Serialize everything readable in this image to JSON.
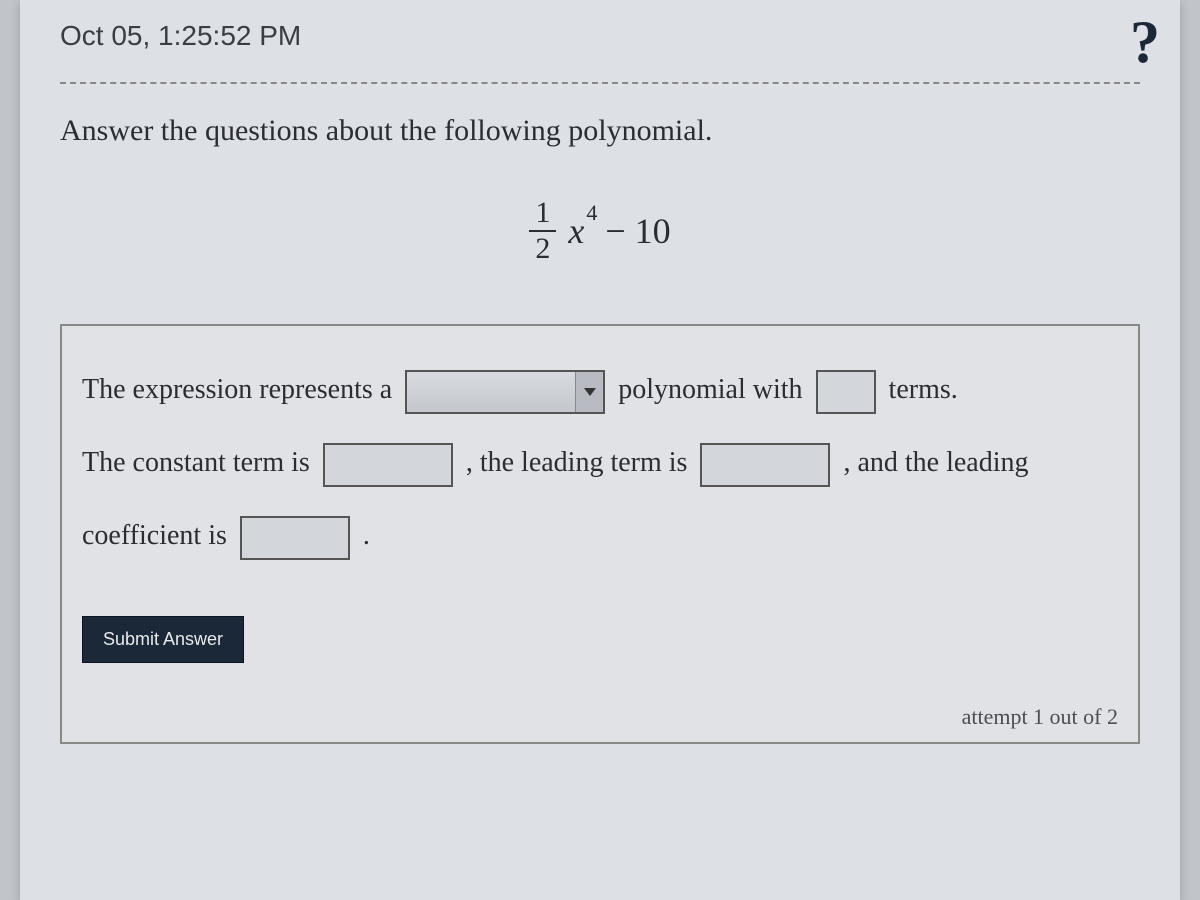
{
  "timestamp": "Oct 05, 1:25:52 PM",
  "prompt": "Answer the questions about the following polynomial.",
  "polynomial": {
    "frac_num": "1",
    "frac_den": "2",
    "variable": "x",
    "exponent": "4",
    "rest": " − 10"
  },
  "sentence": {
    "part1": "The expression represents a ",
    "part2": " polynomial with ",
    "part3": " terms.",
    "line2_a": "The constant term is ",
    "line2_b": ", the leading term is ",
    "line2_c": ", and the leading",
    "line3_a": "coefficient is ",
    "line3_b": "."
  },
  "submit_label": "Submit Answer",
  "attempt_label": "attempt 1 out of 2",
  "help_icon": "?"
}
